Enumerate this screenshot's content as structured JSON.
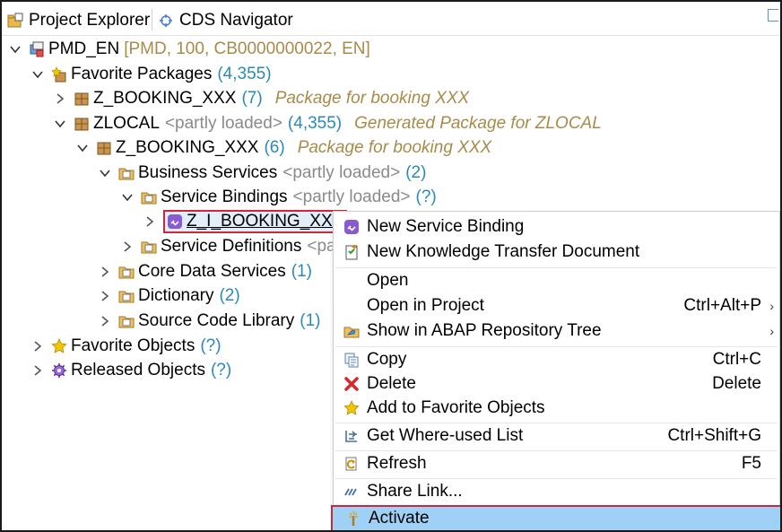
{
  "tabs": {
    "project_explorer": "Project Explorer",
    "cds_navigator": "CDS Navigator"
  },
  "tree": {
    "project": {
      "name": "PMD_EN",
      "meta": "[PMD, 100, CB0000000022, EN]"
    },
    "favorite_packages": {
      "name": "Favorite Packages",
      "count": "(4,355)"
    },
    "z_booking_top": {
      "name": "Z_BOOKING_XXX",
      "count": "(7)",
      "desc": "Package for booking XXX"
    },
    "zlocal": {
      "name": "ZLOCAL",
      "meta": "<partly loaded>",
      "count": "(4,355)",
      "desc": "Generated Package for ZLOCAL"
    },
    "z_booking_sub": {
      "name": "Z_BOOKING_XXX",
      "count": "(6)",
      "desc": "Package for booking XXX"
    },
    "business_services": {
      "name": "Business Services",
      "meta": "<partly loaded>",
      "count": "(2)"
    },
    "service_bindings": {
      "name": "Service Bindings",
      "meta": "<partly loaded>",
      "count": "(?)"
    },
    "selected_binding": {
      "name": "Z_I_BOOKING_XXX"
    },
    "service_definitions": {
      "name": "Service Definitions",
      "meta": "<pa"
    },
    "core_data_services": {
      "name": "Core Data Services",
      "count": "(1)"
    },
    "dictionary": {
      "name": "Dictionary",
      "count": "(2)"
    },
    "source_code_library": {
      "name": "Source Code Library",
      "count": "(1)"
    },
    "favorite_objects": {
      "name": "Favorite Objects",
      "count": "(?)"
    },
    "released_objects": {
      "name": "Released Objects",
      "count": "(?)"
    }
  },
  "context_menu": {
    "new_service_binding": {
      "label": "New Service Binding"
    },
    "new_ktd": {
      "label": "New Knowledge Transfer Document"
    },
    "open": {
      "label": "Open"
    },
    "open_in_project": {
      "label": "Open in Project",
      "shortcut": "Ctrl+Alt+P"
    },
    "show_in_repo": {
      "label": "Show in ABAP Repository Tree"
    },
    "copy": {
      "label": "Copy",
      "shortcut": "Ctrl+C"
    },
    "delete": {
      "label": "Delete",
      "shortcut": "Delete"
    },
    "add_favorite": {
      "label": "Add to Favorite Objects"
    },
    "where_used": {
      "label": "Get Where-used List",
      "shortcut": "Ctrl+Shift+G"
    },
    "refresh": {
      "label": "Refresh",
      "shortcut": "F5"
    },
    "share_link": {
      "label": "Share Link..."
    },
    "activate": {
      "label": "Activate"
    }
  },
  "colors": {
    "count": "#2a8ab7",
    "description": "#a88b4a",
    "meta": "#8a8a8a",
    "highlight_border": "#d0263b",
    "active_item_bg": "#9fd0f5"
  }
}
